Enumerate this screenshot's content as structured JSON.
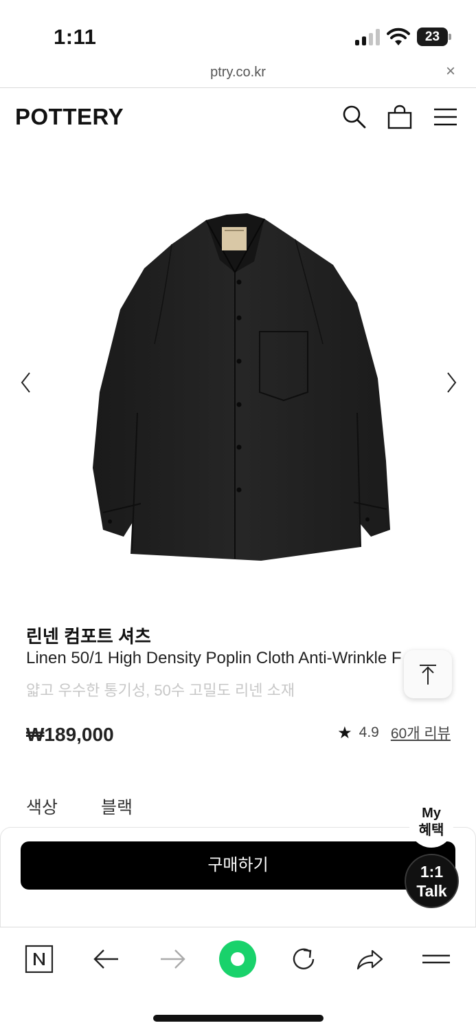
{
  "status_bar": {
    "time": "1:11",
    "battery": "23",
    "icons": [
      "signal-icon",
      "wifi-icon",
      "battery-icon"
    ]
  },
  "browser": {
    "url": "ptry.co.kr",
    "close_icon": "×"
  },
  "header": {
    "logo": "POTTERY",
    "icons": [
      "search-icon",
      "cart-icon",
      "menu-icon"
    ]
  },
  "gallery": {
    "prev_icon": "chevron-left-icon",
    "next_icon": "chevron-right-icon",
    "image": "black-linen-shirt"
  },
  "product": {
    "name_ko": "린넨 컴포트 셔츠",
    "name_en": "Linen 50/1 High Density Poplin Cloth Anti-Wrinkle F",
    "description": "얇고 우수한 통기성, 50수 고밀도 리넨 소재",
    "price": "₩189,000",
    "rating": "4.9",
    "review_link": "60개 리뷰",
    "option_label": "색상",
    "option_value": "블랙"
  },
  "floating": {
    "scroll_top_icon": "arrow-up-icon",
    "my_benefit_line1": "My",
    "my_benefit_line2": "혜택",
    "talk_line1": "1:1",
    "talk_line2": "Talk"
  },
  "buy": {
    "button_label": "구매하기"
  },
  "toolbar": {
    "icons": [
      "naver-icon",
      "back-icon",
      "forward-icon",
      "green-dot-icon",
      "reload-icon",
      "share-icon",
      "menu-icon"
    ]
  },
  "colors": {
    "accent_green": "#19d26b",
    "primary_black": "#000000"
  }
}
